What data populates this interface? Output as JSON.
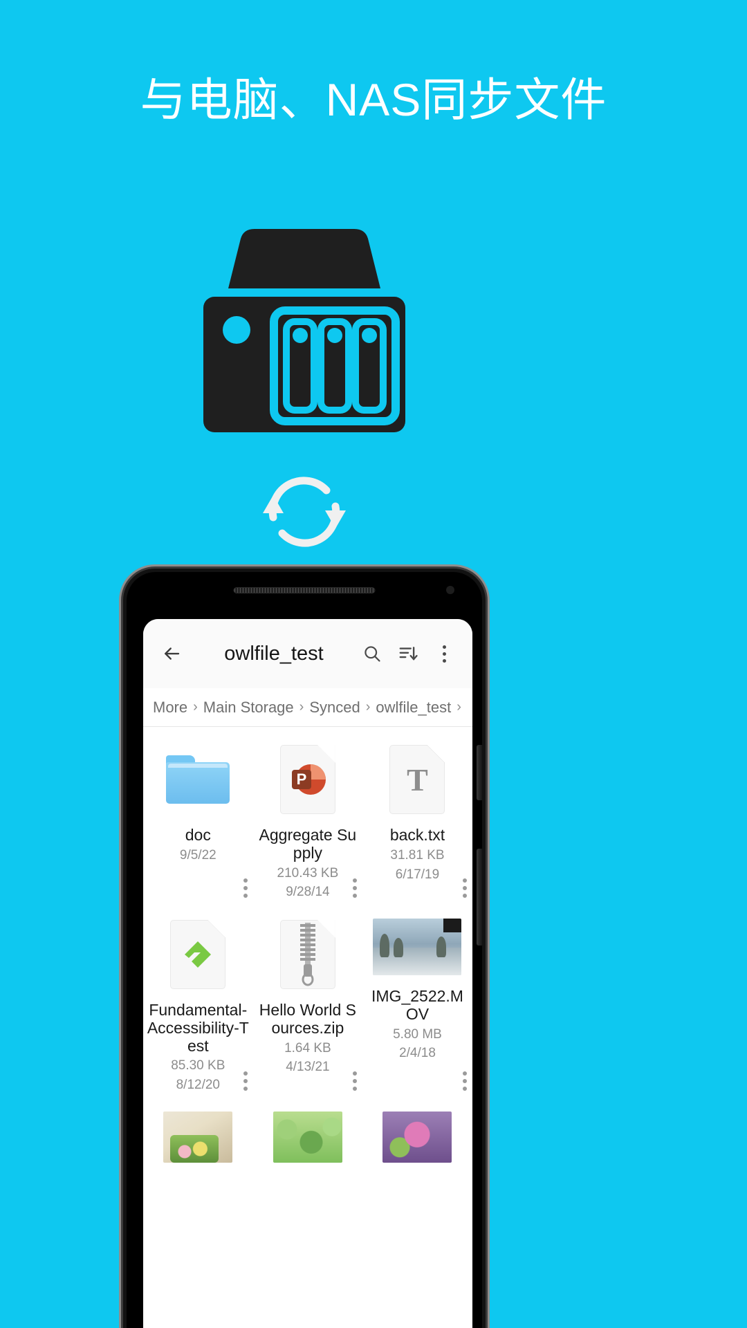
{
  "page": {
    "background_color": "#0ec8f0",
    "headline": "与电脑、NAS同步文件"
  },
  "illustration": {
    "nas_icon": "nas-server-icon",
    "sync_icon": "sync-arrows-icon"
  },
  "phone": {
    "appbar": {
      "back_icon": "back-arrow-icon",
      "title": "owlfile_test",
      "search_icon": "search-icon",
      "sort_icon": "sort-descending-icon",
      "overflow_icon": "more-vertical-icon"
    },
    "breadcrumb": {
      "separator": "›",
      "segments": [
        "More",
        "Main Storage",
        "Synced",
        "owlfile_test"
      ],
      "trailing_separator": "›"
    },
    "files": [
      {
        "name": "doc",
        "size": "",
        "date": "9/5/22",
        "icon": "folder-icon",
        "kind": "folder"
      },
      {
        "name": "Aggregate Supply",
        "size": "210.43 KB",
        "date": "9/28/14",
        "icon": "powerpoint-file-icon",
        "kind": "ppt"
      },
      {
        "name": "back.txt",
        "size": "31.81 KB",
        "date": "6/17/19",
        "icon": "text-file-icon",
        "kind": "txt"
      },
      {
        "name": "Fundamental-Accessibility-Test",
        "size": "85.30 KB",
        "date": "8/12/20",
        "icon": "epub-file-icon",
        "kind": "epub"
      },
      {
        "name": "Hello World Sources.zip",
        "size": "1.64 KB",
        "date": "4/13/21",
        "icon": "zip-file-icon",
        "kind": "zip"
      },
      {
        "name": "IMG_2522.MOV",
        "size": "5.80 MB",
        "date": "2/4/18",
        "icon": "video-thumbnail-icon",
        "kind": "video"
      },
      {
        "name": "",
        "size": "",
        "date": "",
        "icon": "photo-thumbnail-icon",
        "kind": "photo1"
      },
      {
        "name": "",
        "size": "",
        "date": "",
        "icon": "photo-thumbnail-icon",
        "kind": "photo2"
      },
      {
        "name": "",
        "size": "",
        "date": "",
        "icon": "photo-thumbnail-icon",
        "kind": "photo3"
      }
    ]
  },
  "colors": {
    "accent": "#0ec8f0",
    "nas_body": "#1f1f1f",
    "headline_text": "#ffffff",
    "appbar_bg": "#fafafa",
    "file_name_text": "#1a1a1a",
    "file_meta_text": "#8c8c8c"
  }
}
